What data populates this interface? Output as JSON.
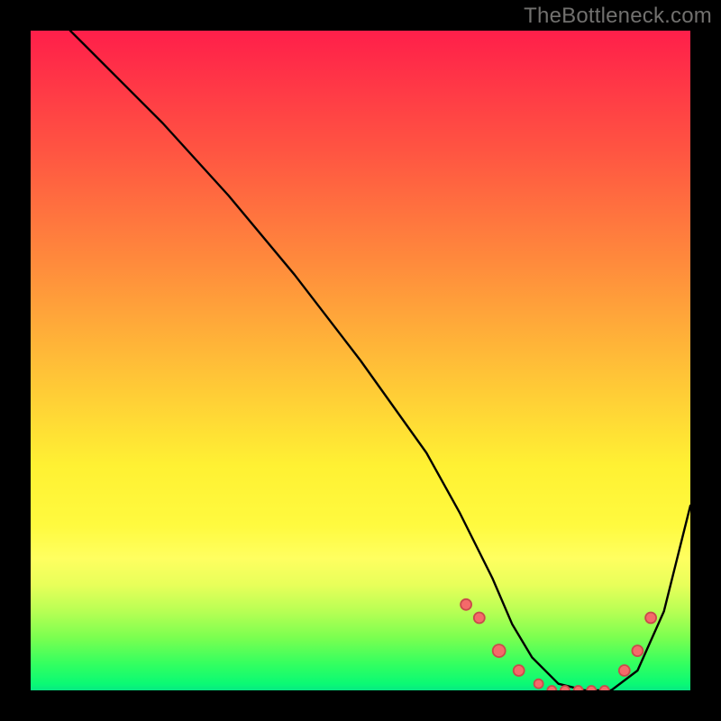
{
  "watermark": "TheBottleneck.com",
  "chart_data": {
    "type": "line",
    "title": "",
    "xlabel": "",
    "ylabel": "",
    "xlim": [
      0,
      100
    ],
    "ylim": [
      0,
      100
    ],
    "series": [
      {
        "name": "curve",
        "x": [
          6,
          8,
          12,
          20,
          30,
          40,
          50,
          60,
          65,
          70,
          73,
          76,
          80,
          84,
          88,
          92,
          96,
          100
        ],
        "y": [
          100,
          98,
          94,
          86,
          75,
          63,
          50,
          36,
          27,
          17,
          10,
          5,
          1,
          0,
          0,
          3,
          12,
          28
        ]
      }
    ],
    "markers": {
      "name": "dots",
      "x": [
        66,
        68,
        71,
        74,
        77,
        79,
        81,
        83,
        85,
        87,
        90,
        92,
        94
      ],
      "y": [
        13,
        11,
        6,
        3,
        1,
        0,
        0,
        0,
        0,
        0,
        3,
        6,
        11
      ],
      "r": [
        6,
        6,
        7,
        6,
        5,
        5,
        5,
        5,
        5,
        5,
        6,
        6,
        6
      ]
    }
  }
}
